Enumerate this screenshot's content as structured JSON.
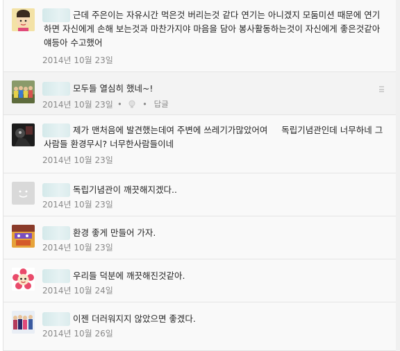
{
  "comments": [
    {
      "avatar": "cartoon-girl-avatar",
      "line1": "근데 주은이는 자유시간 먹은것 버리는것 같다 연기는 아니겠지 모둠미션 때문에 연기",
      "line2": "하면 자신에게 손해 보는것과 마찬가지야 마음을 담아 봉사활동하는것이 자신에게 좋은것같아",
      "line3": "얘등아 수고했어",
      "date": "2014년 10월 23일"
    },
    {
      "avatar": "group-photo-avatar",
      "line1": "모두들 열심히 했네~!",
      "date": "2014년 10월 23일",
      "actions": {
        "like_icon": "lightbulb-icon",
        "reply": "답글",
        "more_icon": "menu-icon"
      }
    },
    {
      "avatar": "dark-photo-avatar",
      "line1": "제가 맨처음에 발견했는데여 주변에 쓰레기가많았어여     독립기념관인데 너무하네 그",
      "line2": "사람들 환경무시? 너무한사람들이네",
      "date": "2014년 10월 23일"
    },
    {
      "avatar": "default-smiley-avatar",
      "line1": "독립기념관이 깨끗해지겠다..",
      "date": "2014년 10월 23일"
    },
    {
      "avatar": "illustration-avatar",
      "line1": "환경 좋게 만들어 가자.",
      "date": "2014년 10월 23일"
    },
    {
      "avatar": "flower-character-avatar",
      "line1": "우리들 덕분에 깨끗해진것같아.",
      "date": "2014년 10월 24일"
    },
    {
      "avatar": "girl-group-avatar",
      "line1": "이젠 더러워지지 않았으면 좋겠다.",
      "date": "2014년 10월 26일"
    }
  ],
  "colors": {
    "background": "#f9f9f9",
    "date": "#888888",
    "text": "#222222",
    "author_blur": "#d4e9ea"
  }
}
